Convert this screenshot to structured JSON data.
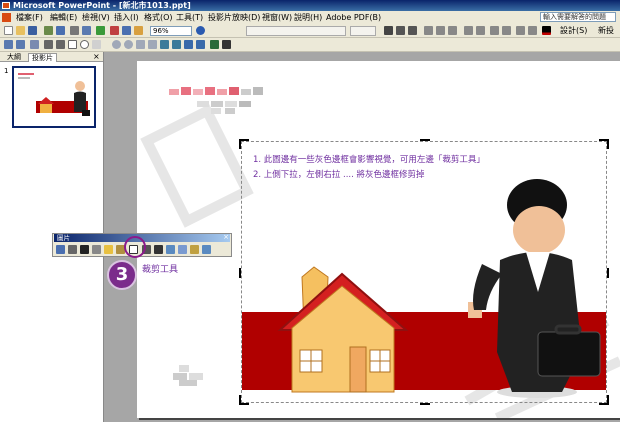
{
  "window": {
    "title": "Microsoft PowerPoint - [新北市1013.ppt]"
  },
  "menu": [
    "檔案(F)",
    "編輯(E)",
    "檢視(V)",
    "插入(I)",
    "格式(O)",
    "工具(T)",
    "投影片放映(D)",
    "視窗(W)",
    "說明(H)",
    "Adobe PDF(B)"
  ],
  "help_placeholder": "輸入需要解答的問題",
  "toolbar": {
    "zoom": "96%",
    "design_label": "設計(S)",
    "new_slide_label": "新投"
  },
  "pane": {
    "tab_outline": "大綱",
    "tab_slides": "投影片",
    "slide_number": "1",
    "close": "×"
  },
  "picture_toolbar": {
    "title": "圖片",
    "close": "×"
  },
  "instructions": [
    "1.  此圖邊有一些灰色邊框會影響視覺，可用左邊「裁剪工具」",
    "2.  上側下拉，左側右拉  ....  將灰色邊框修剪掉"
  ],
  "step_number": "3",
  "crop_label": "裁剪工具",
  "colors": {
    "accent_purple": "#7030a0",
    "banner_red": "#b00000",
    "title_bar": "#0a246a"
  },
  "icons": [
    "crop-icon",
    "insert-picture-icon",
    "color-icon",
    "more-contrast-icon",
    "less-contrast-icon",
    "more-brightness-icon",
    "less-brightness-icon",
    "line-style-icon",
    "compress-icon",
    "rotate-icon",
    "format-picture-icon",
    "transparent-color-icon",
    "reset-picture-icon"
  ]
}
